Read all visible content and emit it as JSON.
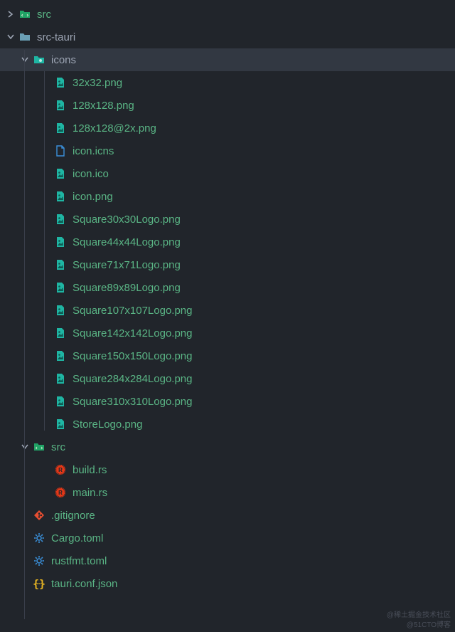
{
  "tree": {
    "src_root": "src",
    "src_tauri": "src-tauri",
    "icons_folder": "icons",
    "icons": [
      "32x32.png",
      "128x128.png",
      "128x128@2x.png",
      "icon.icns",
      "icon.ico",
      "icon.png",
      "Square30x30Logo.png",
      "Square44x44Logo.png",
      "Square71x71Logo.png",
      "Square89x89Logo.png",
      "Square107x107Logo.png",
      "Square142x142Logo.png",
      "Square150x150Logo.png",
      "Square284x284Logo.png",
      "Square310x310Logo.png",
      "StoreLogo.png"
    ],
    "src_inner": "src",
    "rust_files": [
      "build.rs",
      "main.rs"
    ],
    "gitignore": ".gitignore",
    "cargo": "Cargo.toml",
    "rustfmt": "rustfmt.toml",
    "tauri_conf": "tauri.conf.json"
  },
  "watermarks": {
    "top": "@稀土掘金技术社区",
    "bottom": "@51CTO博客"
  }
}
